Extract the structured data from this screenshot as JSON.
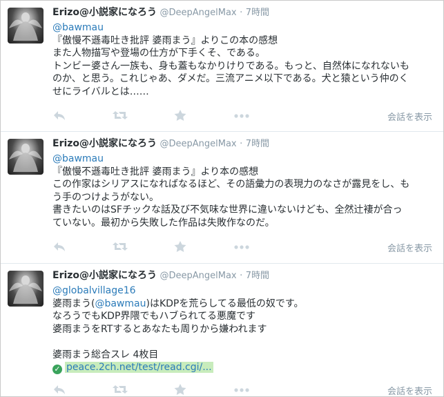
{
  "tweets": [
    {
      "name": "Erizo@小説家になろう",
      "handle": "@DeepAngelMax",
      "sep": "·",
      "time": "7時間",
      "mention": "@bawmau",
      "lines": [
        "『傲慢不遜毒吐き批評 婆雨まう』よりこの本の感想",
        "また人物描写や登場の仕方が下手くそ、である。",
        "トンビー婆さん一族も、身も蓋もなかりけりである。もっと、自然体になれないも",
        "のか、と思う。これじゃあ、ダメだ。三流アニメ以下である。犬と猿という仲のく",
        "せにライバルとは……"
      ],
      "conversation_label": "会話を表示"
    },
    {
      "name": "Erizo@小説家になろう",
      "handle": "@DeepAngelMax",
      "sep": "·",
      "time": "7時間",
      "mention": "@bawmau",
      "lines": [
        "『傲慢不遜毒吐き批評 婆雨まう』より本の感想",
        "この作家はシリアスになればなるほど、その語彙力の表現力のなさが露見をし、も",
        "う手のつけようがない。",
        "書きたいのはSFチックな話及び不気味な世界に違いないけども、全然辻褄が合っ",
        "ていない。最初から失敗した作品は失敗作なのだ。"
      ],
      "conversation_label": "会話を表示"
    },
    {
      "name": "Erizo@小説家になろう",
      "handle": "@DeepAngelMax",
      "sep": "·",
      "time": "7時間",
      "mention": "@globalvillage16",
      "line1_prefix": "婆雨まう(",
      "line1_mention": "@bawmau",
      "line1_suffix": ")はKDPを荒らしてる最低の奴です。",
      "lines": [
        "なろうでもKDP界隈でもハブられてる悪魔です",
        "婆雨まうをRTするとあなたも周りから嫌われます",
        "",
        "婆雨まう総合スレ 4枚目"
      ],
      "link_text": "peace.2ch.net/test/read.cgi/...",
      "conversation_label": "会話を表示"
    }
  ],
  "icons": {
    "reply": "reply-arrow-icon",
    "retweet": "retweet-icon",
    "favorite": "star-icon",
    "more": "more-dots-icon",
    "link_check": "check-circle-icon"
  },
  "colors": {
    "link": "#2b7bb9",
    "meta": "#8899a6",
    "icon": "#ccd6dd",
    "link_highlight": "#c8ecbc"
  }
}
